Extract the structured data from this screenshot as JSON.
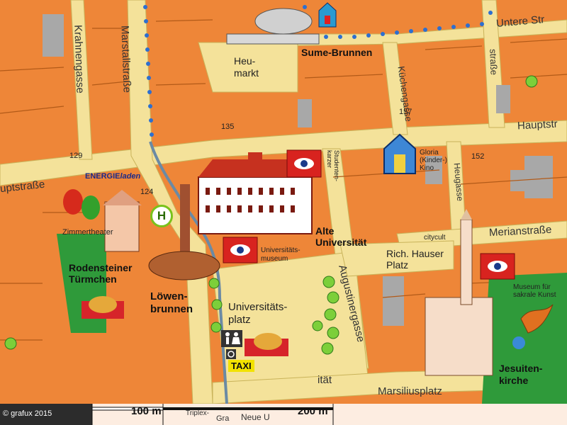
{
  "map": {
    "streets": {
      "untere_strasse": "Untere Str",
      "hauptstrasse_left": "uptstraße",
      "hauptstrasse_right": "Hauptstr",
      "marstallstrasse": "Marstallstraße",
      "krahnengasse": "Krahnengasse",
      "kuechengasse": "Küchengasse",
      "augustinergasse": "Augustinergasse",
      "heugasse": "Heugasse",
      "merianstrasse": "Merianstraße",
      "strasse_top": "straße",
      "marsiliusplatz": "Marsiliusplatz",
      "universitaet_bottom": "ität",
      "grabengasse_hint": "Gra",
      "neue_universitaet_hint": "Neue U",
      "triplex_hint": "Triplex-"
    },
    "places": {
      "sume_brunnen": "Sume-Brunnen",
      "heumarkt": "Heu-\nmarkt",
      "energieladen_bold": "ENERGIE",
      "energieladen_italic": "laden",
      "zimmertheater": "Zimmertheater",
      "rodensteiner": "Rodensteiner\nTürmchen",
      "loewenbrunnen": "Löwen-\nbrunnen",
      "alte_universitaet": "Alte\nUniversität",
      "universitaetsmuseum": "Universitäts-\nmuseum",
      "studentenkarzer": "Studenten-\nkarzer",
      "universitaetsplatz": "Universitäts-\nplatz",
      "gloria_kino": "Gloria\n(Kinder-)\nKino",
      "citycult": "citycult",
      "rich_hauser_platz": "Rich. Hauser\nPlatz",
      "museum_sakrale_kunst": "Museum für\nsakrale Kunst",
      "jesuitenkirche": "Jesuiten-\nkirche",
      "taxi": "TAXI",
      "bus_stop": "H"
    },
    "house_numbers": {
      "n135": "135",
      "n157": "157",
      "n129": "129",
      "n124": "124",
      "n152": "152"
    },
    "scale": {
      "copyright": "© grafux 2015",
      "s100": "100 m",
      "s200": "200 m"
    },
    "colors": {
      "building_orange": "#ef8a3c",
      "building_light": "#f7b35a",
      "street_yellow": "#f5e48c",
      "park_green": "#2f9a3a",
      "route_blue": "#2d6fd0",
      "eye_red": "#d8231f"
    }
  }
}
